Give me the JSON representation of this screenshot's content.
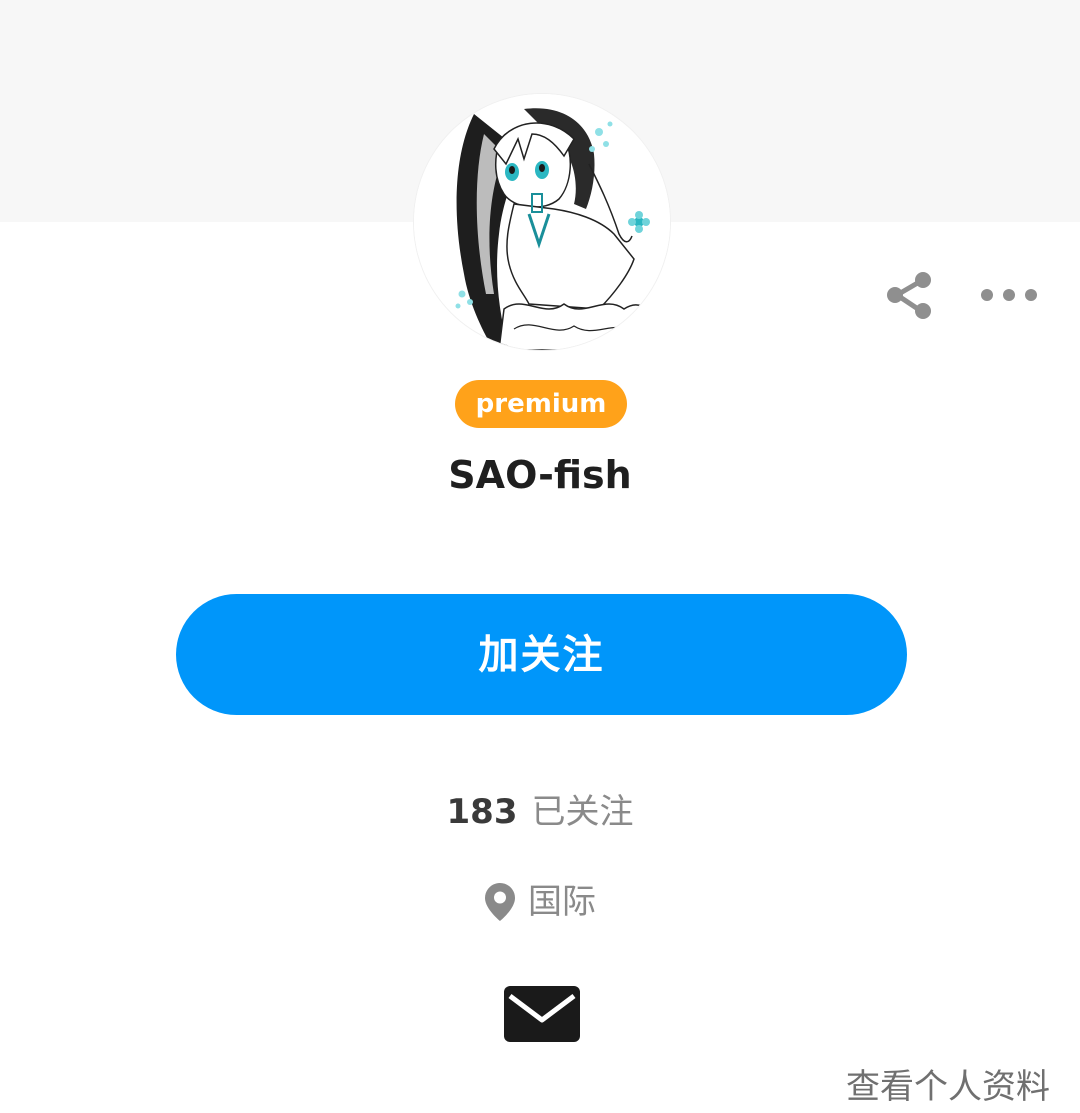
{
  "profile": {
    "badge": "premium",
    "username": "SAO-fish",
    "following_count": "183",
    "following_label": "已关注",
    "location": "国际"
  },
  "actions": {
    "follow_label": "加关注",
    "view_profile_label": "查看个人资料"
  },
  "icons": {
    "share": "share-icon",
    "more": "more-options-icon",
    "location": "location-pin-icon",
    "mail": "mail-icon"
  },
  "colors": {
    "accent": "#0096fa",
    "badge": "#ffa21a",
    "cover": "#f7f7f7"
  }
}
